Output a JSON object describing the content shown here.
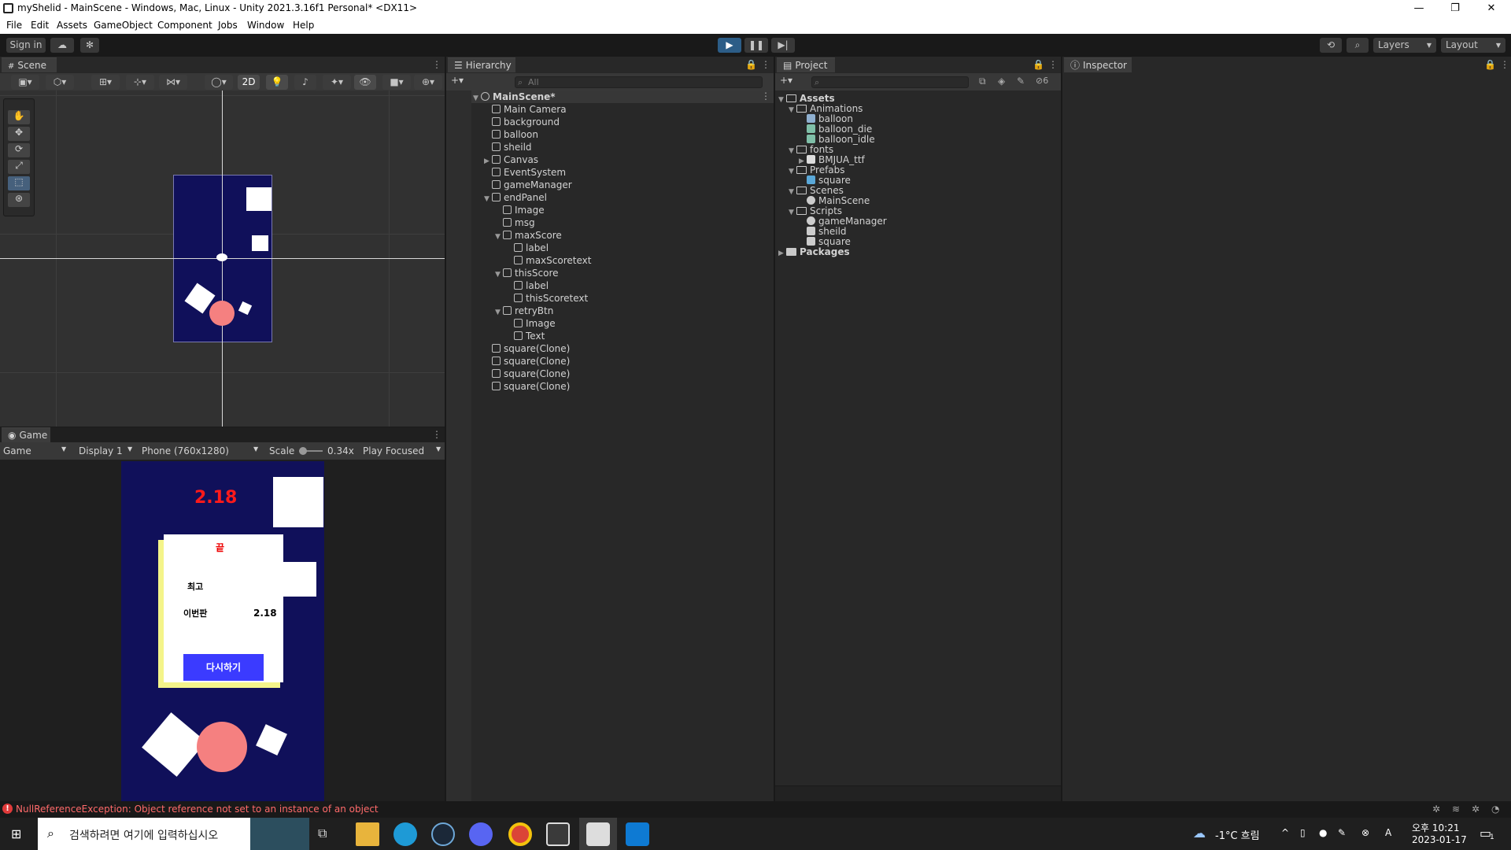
{
  "window": {
    "title": "myShelid - MainScene - Windows, Mac, Linux - Unity 2021.3.16f1 Personal* <DX11>",
    "minimize": "—",
    "restore": "❐",
    "close": "✕"
  },
  "menu": [
    "File",
    "Edit",
    "Assets",
    "GameObject",
    "Component",
    "Jobs",
    "Window",
    "Help"
  ],
  "toolbar": {
    "sign_in": "Sign in",
    "layers": "Layers",
    "layout": "Layout",
    "accent": "#2c5d87"
  },
  "scene": {
    "tab": "Scene",
    "mode_2d": "2D",
    "background": "#313131",
    "camera_color": "#10105a"
  },
  "game": {
    "tab": "Game",
    "view": "Game",
    "display": "Display 1",
    "resolution": "Phone (760x1280)",
    "scale_label": "Scale",
    "scale_value": "0.34x",
    "play_mode": "Play Focused",
    "score_top": "2.18",
    "panel_icon": "끝",
    "best_label": "최고",
    "this_label": "이번판",
    "this_value": "2.18",
    "retry_label": "다시하기"
  },
  "hierarchy": {
    "tab": "Hierarchy",
    "search_placeholder": "All",
    "items": [
      {
        "label": "MainScene*",
        "depth": 0,
        "kind": "scene",
        "arrow": "▼"
      },
      {
        "label": "Main Camera",
        "depth": 1,
        "kind": "obj",
        "arrow": ""
      },
      {
        "label": "background",
        "depth": 1,
        "kind": "obj",
        "arrow": ""
      },
      {
        "label": "balloon",
        "depth": 1,
        "kind": "obj",
        "arrow": ""
      },
      {
        "label": "sheild",
        "depth": 1,
        "kind": "obj",
        "arrow": ""
      },
      {
        "label": "Canvas",
        "depth": 1,
        "kind": "obj",
        "arrow": "▶"
      },
      {
        "label": "EventSystem",
        "depth": 1,
        "kind": "obj",
        "arrow": ""
      },
      {
        "label": "gameManager",
        "depth": 1,
        "kind": "obj",
        "arrow": ""
      },
      {
        "label": "endPanel",
        "depth": 1,
        "kind": "obj",
        "arrow": "▼"
      },
      {
        "label": "Image",
        "depth": 2,
        "kind": "obj",
        "arrow": ""
      },
      {
        "label": "msg",
        "depth": 2,
        "kind": "obj",
        "arrow": ""
      },
      {
        "label": "maxScore",
        "depth": 2,
        "kind": "obj",
        "arrow": "▼"
      },
      {
        "label": "label",
        "depth": 3,
        "kind": "obj",
        "arrow": ""
      },
      {
        "label": "maxScoretext",
        "depth": 3,
        "kind": "obj",
        "arrow": ""
      },
      {
        "label": "thisScore",
        "depth": 2,
        "kind": "obj",
        "arrow": "▼"
      },
      {
        "label": "label",
        "depth": 3,
        "kind": "obj",
        "arrow": ""
      },
      {
        "label": "thisScoretext",
        "depth": 3,
        "kind": "obj",
        "arrow": ""
      },
      {
        "label": "retryBtn",
        "depth": 2,
        "kind": "obj",
        "arrow": "▼"
      },
      {
        "label": "Image",
        "depth": 3,
        "kind": "obj",
        "arrow": ""
      },
      {
        "label": "Text",
        "depth": 3,
        "kind": "obj",
        "arrow": ""
      },
      {
        "label": "square(Clone)",
        "depth": 1,
        "kind": "obj",
        "arrow": ""
      },
      {
        "label": "square(Clone)",
        "depth": 1,
        "kind": "obj",
        "arrow": ""
      },
      {
        "label": "square(Clone)",
        "depth": 1,
        "kind": "obj",
        "arrow": ""
      },
      {
        "label": "square(Clone)",
        "depth": 1,
        "kind": "obj",
        "arrow": ""
      }
    ]
  },
  "project": {
    "tab": "Project",
    "hidden_count": "6",
    "items": [
      {
        "label": "Assets",
        "depth": 0,
        "kind": "folder-open",
        "arrow": "▼",
        "bold": true
      },
      {
        "label": "Animations",
        "depth": 1,
        "kind": "folder-open",
        "arrow": "▼"
      },
      {
        "label": "balloon",
        "depth": 2,
        "kind": "anim-controller",
        "arrow": ""
      },
      {
        "label": "balloon_die",
        "depth": 2,
        "kind": "anim-clip",
        "arrow": ""
      },
      {
        "label": "balloon_idle",
        "depth": 2,
        "kind": "anim-clip",
        "arrow": ""
      },
      {
        "label": "fonts",
        "depth": 1,
        "kind": "folder-open",
        "arrow": "▼"
      },
      {
        "label": "BMJUA_ttf",
        "depth": 2,
        "kind": "font",
        "arrow": "▶"
      },
      {
        "label": "Prefabs",
        "depth": 1,
        "kind": "folder-open",
        "arrow": "▼"
      },
      {
        "label": "square",
        "depth": 2,
        "kind": "prefab",
        "arrow": ""
      },
      {
        "label": "Scenes",
        "depth": 1,
        "kind": "folder-open",
        "arrow": "▼"
      },
      {
        "label": "MainScene",
        "depth": 2,
        "kind": "scene",
        "arrow": ""
      },
      {
        "label": "Scripts",
        "depth": 1,
        "kind": "folder-open",
        "arrow": "▼"
      },
      {
        "label": "gameManager",
        "depth": 2,
        "kind": "manager-script",
        "arrow": ""
      },
      {
        "label": "sheild",
        "depth": 2,
        "kind": "script",
        "arrow": ""
      },
      {
        "label": "square",
        "depth": 2,
        "kind": "script",
        "arrow": ""
      },
      {
        "label": "Packages",
        "depth": 0,
        "kind": "folder",
        "arrow": "▶",
        "bold": true
      }
    ]
  },
  "inspector": {
    "tab": "Inspector"
  },
  "status": {
    "message": "NullReferenceException: Object reference not set to an instance of an object",
    "color": "#ff6a6a"
  },
  "taskbar": {
    "search_placeholder": "검색하려면 여기에 입력하십시오",
    "weather": "-1°C 흐림",
    "time": "오후 10:21",
    "date": "2023-01-17",
    "notification_count": "1",
    "ime": "A"
  }
}
